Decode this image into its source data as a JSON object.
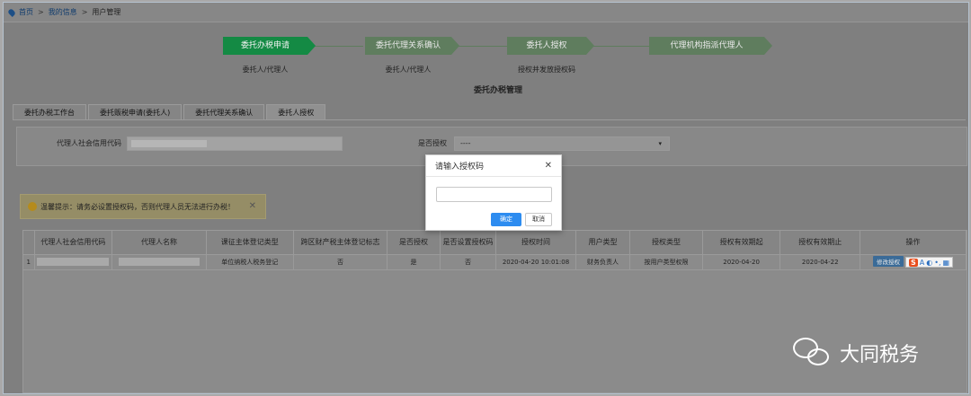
{
  "breadcrumb": {
    "home": "首页",
    "sep1": ">",
    "my_info": "我的信息",
    "sep2": ">",
    "current": "用户管理"
  },
  "steps": [
    {
      "label": "委托办税申请",
      "sub": "委托人/代理人",
      "active": true
    },
    {
      "label": "委托代理关系确认",
      "sub": "委托人/代理人",
      "active": false
    },
    {
      "label": "委托人授权",
      "sub": "授权并发放授权码",
      "active": false
    },
    {
      "label": "代理机构指派代理人",
      "sub": "",
      "active": false
    }
  ],
  "section_title": "委托办税管理",
  "tabs": [
    {
      "label": "委托办税工作台",
      "active": false
    },
    {
      "label": "委托贩税申请(委托人)",
      "active": false
    },
    {
      "label": "委托代理关系确认",
      "active": false
    },
    {
      "label": "委托人授权",
      "active": true
    }
  ],
  "filters": {
    "credit_code_label": "代理人社会信用代码",
    "authorized_label": "是否授权",
    "authorized_value": "----",
    "caret": "▾"
  },
  "warning": {
    "text": "温馨提示：请务必设置授权码，否则代理人员无法进行办税！",
    "close": "✕"
  },
  "table": {
    "headers": [
      "",
      "代理人社会信用代码",
      "代理人名称",
      "课征主体登记类型",
      "跨区财产税主体登记标志",
      "是否授权",
      "是否设置授权码",
      "授权时间",
      "用户类型",
      "授权类型",
      "授权有效期起",
      "授权有效期止",
      "操作"
    ],
    "rows": [
      {
        "num": "1",
        "reg_type": "单位纳税人税务登记",
        "cross_region": "否",
        "authorized": "是",
        "code_set": "否",
        "auth_time": "2020-04-20 10:01:08",
        "user_type": "财务负责人",
        "auth_type": "按用户类型权限",
        "valid_from": "2020-04-20",
        "valid_to": "2020-04-22",
        "op_label": "修改授权"
      }
    ]
  },
  "ime": {
    "logo": "S",
    "items": [
      "A",
      "◐",
      "•,",
      "▦"
    ]
  },
  "watermark": {
    "text": "大同税务"
  },
  "modal": {
    "title": "请输入授权码",
    "close": "✕",
    "input_value": "",
    "ok_label": "确定",
    "cancel_label": "取消"
  },
  "colors": {
    "primary_button": "#2d8cf0",
    "step_active": "#148a44",
    "warning_icon": "#b58b1c"
  }
}
